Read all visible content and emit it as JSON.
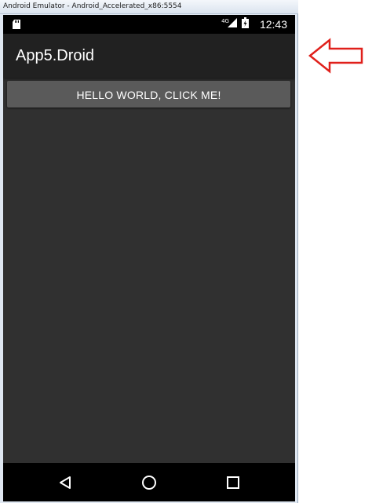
{
  "window": {
    "title": "Android Emulator - Android_Accelerated_x86:5554"
  },
  "status_bar": {
    "network_label": "4G",
    "time": "12:43",
    "icons": [
      "sd-card-icon",
      "signal-icon",
      "battery-icon"
    ]
  },
  "action_bar": {
    "title": "App5.Droid"
  },
  "content": {
    "button_label": "HELLO WORLD, CLICK ME!"
  },
  "nav_bar": {
    "icons": [
      "back-icon",
      "home-icon",
      "recent-apps-icon"
    ]
  },
  "annotation": {
    "arrow_color": "#e0201b",
    "arrow_icon": "left-arrow-outline-icon"
  },
  "colors": {
    "screen_bg": "#303030",
    "action_bar_bg": "#212121",
    "button_bg": "#5a5a5a",
    "status_bar_bg": "#000000"
  }
}
